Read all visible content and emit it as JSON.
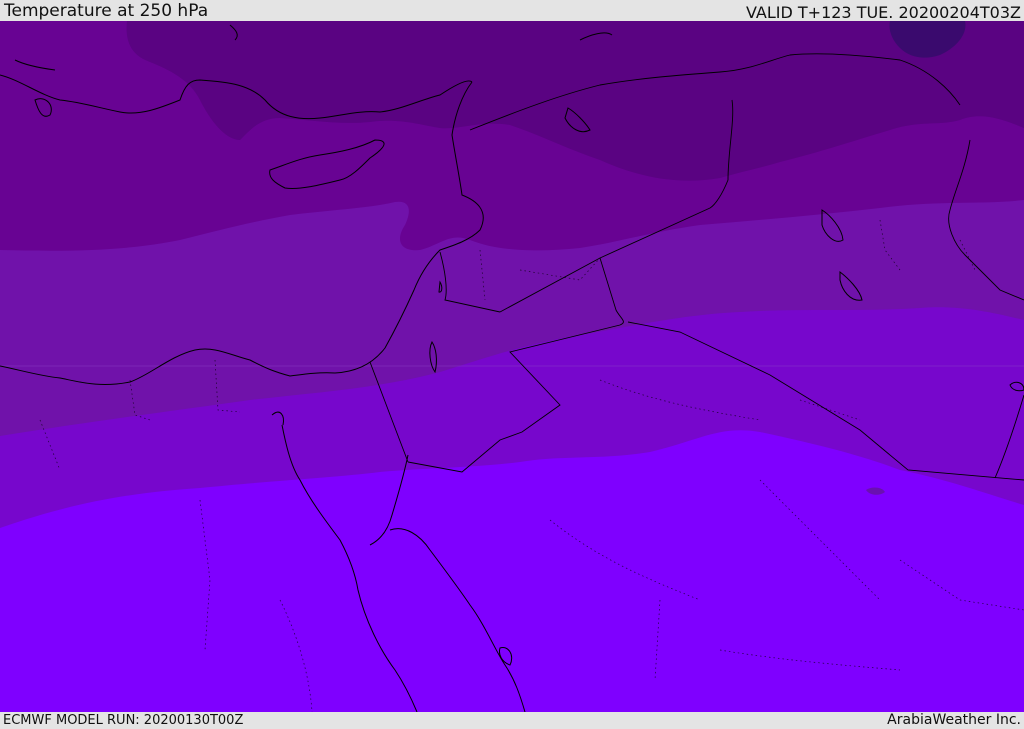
{
  "header": {
    "title": "Temperature at 250 hPa",
    "valid": "VALID T+123 TUE. 20200204T03Z"
  },
  "footer": {
    "model_run": "ECMWF MODEL RUN: 20200130T00Z",
    "credit": "ArabiaWeather Inc."
  },
  "colors": {
    "background_bars": "#e4e4e4",
    "band_darkest": "#3a0a6e",
    "band_1": "#5a0382",
    "band_2": "#680393",
    "band_3": "#7012aa",
    "band_4": "#7707cc",
    "band_5": "#7f00ff",
    "coastline": "#000000"
  },
  "map": {
    "field": "temperature",
    "level_hpa": 250
  }
}
